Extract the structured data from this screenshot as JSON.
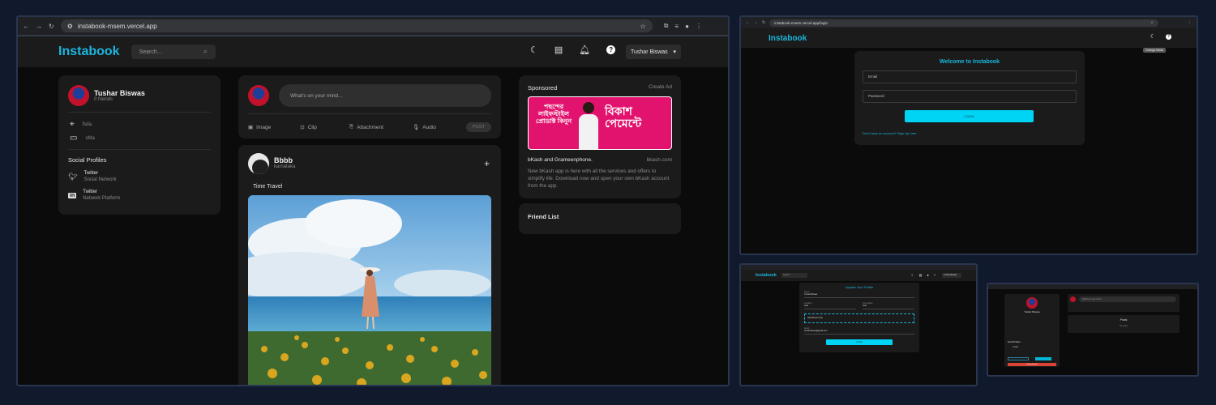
{
  "main": {
    "url": "instabook-msem.vercel.app",
    "brand": "Instabook",
    "search_placeholder": "Search...",
    "user_menu_label": "Tushar Biswas",
    "profile": {
      "name": "Tushar Biswas",
      "friends": "0 friends",
      "location": "fsda",
      "occupation": "sfda"
    },
    "social": {
      "heading": "Social Profiles",
      "items": [
        {
          "name": "Twitter",
          "sub": "Social Network"
        },
        {
          "name": "Twitter",
          "sub": "Network Platform"
        }
      ]
    },
    "composer": {
      "placeholder": "What's on your mind...",
      "image": "Image",
      "clip": "Clip",
      "attachment": "Attachment",
      "audio": "Audio",
      "post": "POST"
    },
    "post": {
      "author": "Bbbb",
      "location": "karnataka",
      "caption": "Time Travel"
    },
    "ad": {
      "heading": "Sponsored",
      "create": "Create Ad",
      "title": "bKash and Grameenphone.",
      "domain": "bkash.com",
      "text": "New bKash app is here with all the services and offers to simplify life. Download now and open your own bKash account from the app.",
      "banner_left": "পছন্দের লাইফস্টাইল প্রোডাক্ট কিনুন",
      "banner_right": "বিকাশ পেমেন্টে"
    },
    "friend_list": "Friend List"
  },
  "login": {
    "url": "instabook-msem.vercel.app/login",
    "brand": "Instabook",
    "tooltip": "Change Mode",
    "title": "Welcome to Instabook",
    "email_placeholder": "Email",
    "password_placeholder": "Password",
    "login_button": "LOGIN",
    "signup_link": "Don't have an account? Sign Up here."
  },
  "edit": {
    "brand": "Instabook",
    "search": "Search...",
    "user": "Tushar Biswas",
    "title": "Update Your Profile",
    "name_label": "Name",
    "name_value": "Tushar Biswas",
    "location_label": "Location",
    "location_value": "fsda",
    "occupation_label": "Occupation",
    "occupation_value": "sfda",
    "upload_label": "Add Picture Here",
    "email_label": "Email",
    "email_value": "tusharbiswas@gmail.com",
    "submit": "Update"
  },
  "small": {
    "name": "Tushar Biswas",
    "composer": "What's on your mind...",
    "posts_title": "Posts",
    "posts_empty": "No posts",
    "social_heading": "Social Profiles",
    "twitter": "Twitter",
    "delete_label": "Delete Account"
  }
}
